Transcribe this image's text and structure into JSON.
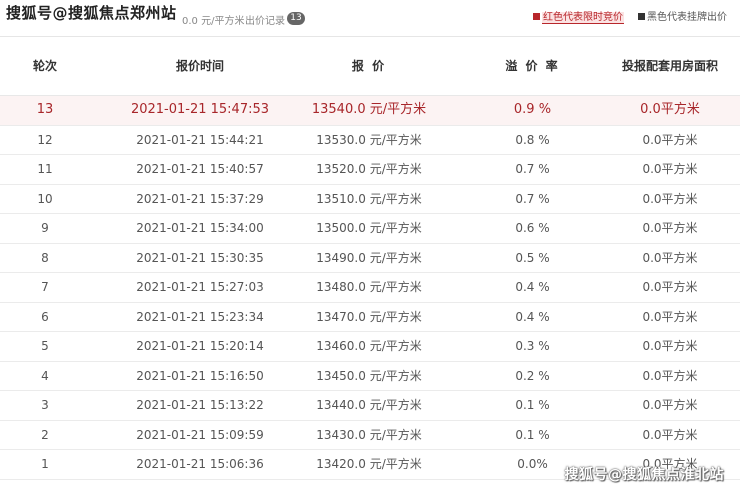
{
  "header": {
    "title_overlay": "搜狐号@搜狐焦点郑州站",
    "price_fragment": "0.0 元/平方米",
    "record_label": "出价记录",
    "record_count": "13",
    "legend_red": "红色代表限时竞价",
    "legend_black": "黑色代表挂牌出价"
  },
  "columns": {
    "round": "轮次",
    "time": "报价时间",
    "price": "报 价",
    "premium": "溢 价 率",
    "area": "投报配套用房面积"
  },
  "rows": [
    {
      "round": "13",
      "time": "2021-01-21 15:47:53",
      "price": "13540.0 元/平方米",
      "premium": "0.9 %",
      "area": "0.0平方米"
    },
    {
      "round": "12",
      "time": "2021-01-21 15:44:21",
      "price": "13530.0 元/平方米",
      "premium": "0.8 %",
      "area": "0.0平方米"
    },
    {
      "round": "11",
      "time": "2021-01-21 15:40:57",
      "price": "13520.0 元/平方米",
      "premium": "0.7 %",
      "area": "0.0平方米"
    },
    {
      "round": "10",
      "time": "2021-01-21 15:37:29",
      "price": "13510.0 元/平方米",
      "premium": "0.7 %",
      "area": "0.0平方米"
    },
    {
      "round": "9",
      "time": "2021-01-21 15:34:00",
      "price": "13500.0 元/平方米",
      "premium": "0.6 %",
      "area": "0.0平方米"
    },
    {
      "round": "8",
      "time": "2021-01-21 15:30:35",
      "price": "13490.0 元/平方米",
      "premium": "0.5 %",
      "area": "0.0平方米"
    },
    {
      "round": "7",
      "time": "2021-01-21 15:27:03",
      "price": "13480.0 元/平方米",
      "premium": "0.4 %",
      "area": "0.0平方米"
    },
    {
      "round": "6",
      "time": "2021-01-21 15:23:34",
      "price": "13470.0 元/平方米",
      "premium": "0.4 %",
      "area": "0.0平方米"
    },
    {
      "round": "5",
      "time": "2021-01-21 15:20:14",
      "price": "13460.0 元/平方米",
      "premium": "0.3 %",
      "area": "0.0平方米"
    },
    {
      "round": "4",
      "time": "2021-01-21 15:16:50",
      "price": "13450.0 元/平方米",
      "premium": "0.2 %",
      "area": "0.0平方米"
    },
    {
      "round": "3",
      "time": "2021-01-21 15:13:22",
      "price": "13440.0 元/平方米",
      "premium": "0.1 %",
      "area": "0.0平方米"
    },
    {
      "round": "2",
      "time": "2021-01-21 15:09:59",
      "price": "13430.0 元/平方米",
      "premium": "0.1 %",
      "area": "0.0平方米"
    },
    {
      "round": "1",
      "time": "2021-01-21 15:06:36",
      "price": "13420.0 元/平方米",
      "premium": "0.0%",
      "area": "0.0平方米"
    }
  ],
  "watermark": "搜狐号@搜狐焦点淮北站",
  "colors": {
    "highlight_text": "#a8262a",
    "highlight_bg": "#fcf3f3",
    "legend_red": "#b8262b",
    "row_text": "#555555"
  }
}
